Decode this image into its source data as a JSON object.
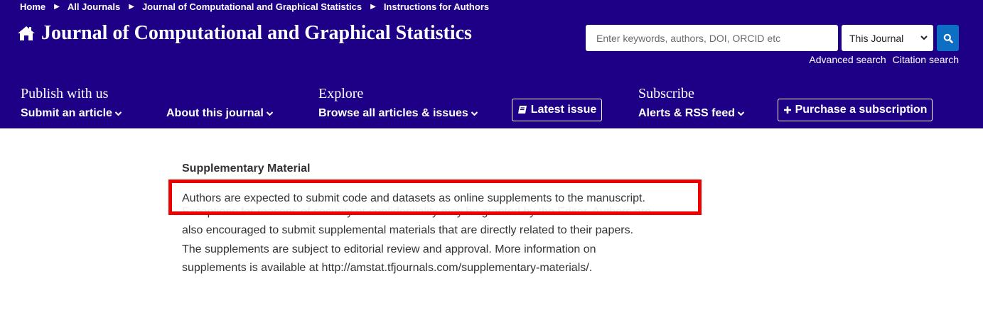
{
  "breadcrumb": [
    {
      "label": "Home"
    },
    {
      "label": "All Journals"
    },
    {
      "label": "Journal of Computational and Graphical Statistics"
    },
    {
      "label": "Instructions for Authors"
    }
  ],
  "header": {
    "journal_title": "Journal of Computational and Graphical Statistics",
    "background_color": "#1e0087",
    "home_icon": "home-icon"
  },
  "search": {
    "placeholder": "Enter keywords, authors, DOI, ORCID etc",
    "value": "",
    "scope_selected": "This Journal",
    "button_icon": "search-icon",
    "advanced_label": "Advanced search",
    "citation_label": "Citation search",
    "button_color": "#0d6fc4"
  },
  "nav": {
    "publish": {
      "heading": "Publish with us",
      "link": "Submit an article"
    },
    "about": {
      "link": "About this journal"
    },
    "explore": {
      "heading": "Explore",
      "link": "Browse all articles & issues"
    },
    "latest_issue": {
      "label": "Latest issue",
      "icon": "book-icon"
    },
    "subscribe": {
      "heading": "Subscribe",
      "link": "Alerts & RSS feed"
    },
    "purchase": {
      "label": "Purchase a subscription",
      "icon": "plus-icon"
    }
  },
  "content": {
    "section_title": "Supplementary Material",
    "highlighted_sentence": "Authors are expected to submit code and datasets as online supplements to the manuscript.",
    "paragraph_lines": [
      "Exceptions for reasons of security or confidentiality may be granted by the Editor. Authors are",
      "also encouraged to submit supplemental materials that are directly related to their papers.",
      "The supplements are subject to editorial review and approval. More information on",
      "supplements is available at http://amstat.tfjournals.com/supplementary-materials/."
    ],
    "highlight_color": "#ee0000"
  }
}
